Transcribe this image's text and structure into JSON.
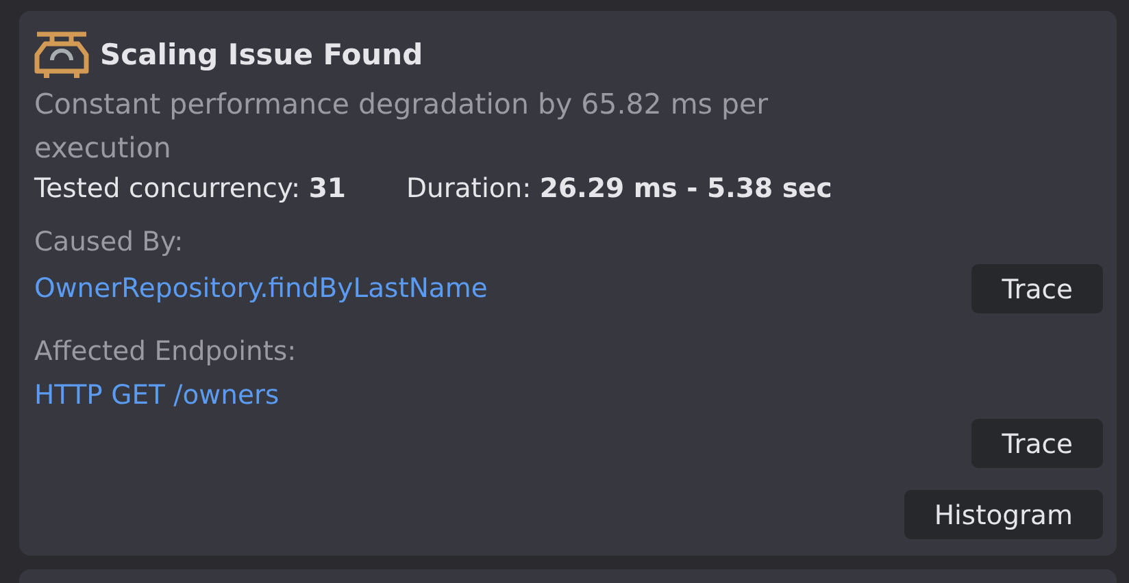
{
  "title": "Scaling Issue Found",
  "description": "Constant performance degradation by 65.82 ms per execution",
  "stats": [
    {
      "label": "Tested concurrency:",
      "value": "31"
    },
    {
      "label": "Duration:",
      "value": "26.29 ms - 5.38 sec"
    }
  ],
  "caused_by": {
    "label": "Caused By:",
    "link": "OwnerRepository.findByLastName",
    "button": "Trace"
  },
  "affected_endpoints": {
    "label": "Affected Endpoints:",
    "link": "HTTP GET /owners"
  },
  "buttons": [
    "Trace",
    "Histogram"
  ]
}
